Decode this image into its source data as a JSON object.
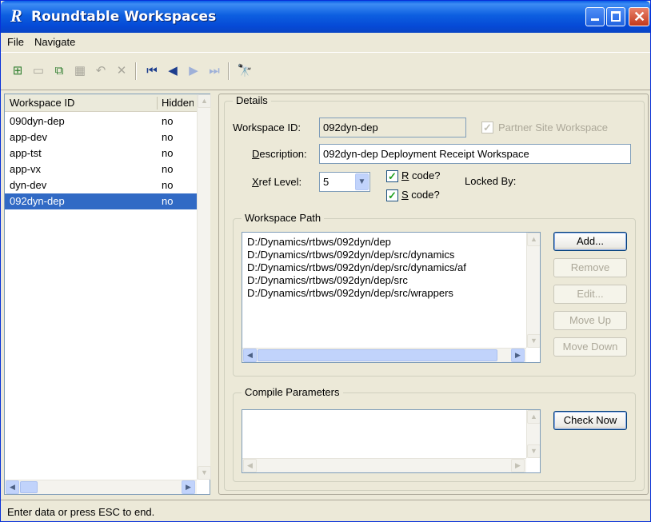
{
  "window": {
    "title": "Roundtable Workspaces",
    "app_icon_letter": "R"
  },
  "menu": {
    "items": [
      "File",
      "Navigate"
    ]
  },
  "toolbar": {
    "icons": [
      "add-icon",
      "grid-icon",
      "copy-icon",
      "save-icon",
      "undo-icon",
      "delete-icon",
      "first-icon",
      "prev-icon",
      "next-icon",
      "last-icon",
      "find-icon"
    ]
  },
  "workspace_list": {
    "columns": [
      "Workspace ID",
      "Hidden"
    ],
    "rows": [
      {
        "id": "090dyn-dep",
        "hidden": "no"
      },
      {
        "id": "app-dev",
        "hidden": "no"
      },
      {
        "id": "app-tst",
        "hidden": "no"
      },
      {
        "id": "app-vx",
        "hidden": "no"
      },
      {
        "id": "dyn-dev",
        "hidden": "no"
      },
      {
        "id": "092dyn-dep",
        "hidden": "no"
      }
    ],
    "selected_index": 5
  },
  "details": {
    "group_title": "Details",
    "workspace_id_label": "Workspace ID:",
    "workspace_id_value": "092dyn-dep",
    "partner_site_label": "Partner Site Workspace",
    "partner_site_checked": true,
    "description_label_first": "D",
    "description_label_rest": "escription:",
    "description_value": "092dyn-dep Deployment Receipt Workspace",
    "xref_label_first": "X",
    "xref_label_rest": "ref Level:",
    "xref_value": "5",
    "r_code_first": "R",
    "r_code_rest": " code?",
    "r_code_checked": true,
    "s_code_first": "S",
    "s_code_rest": " code?",
    "s_code_checked": true,
    "locked_by_label": "Locked By:"
  },
  "workspace_path": {
    "group_title": "Workspace Path",
    "paths": [
      "D:/Dynamics/rtbws/092dyn/dep",
      "D:/Dynamics/rtbws/092dyn/dep/src/dynamics",
      "D:/Dynamics/rtbws/092dyn/dep/src/dynamics/af",
      "D:/Dynamics/rtbws/092dyn/dep/src",
      "D:/Dynamics/rtbws/092dyn/dep/src/wrappers"
    ],
    "buttons": {
      "add": "Add...",
      "remove": "Remove",
      "edit": "Edit...",
      "move_up": "Move Up",
      "move_down": "Move Down"
    }
  },
  "compile": {
    "group_title": "Compile Parameters",
    "value": "",
    "check_now": "Check Now"
  },
  "status": {
    "text": "Enter data or press ESC to end."
  },
  "colors": {
    "title_bar": "#0a5ee8",
    "selection": "#316ac5",
    "window_bg": "#ece9d8"
  }
}
